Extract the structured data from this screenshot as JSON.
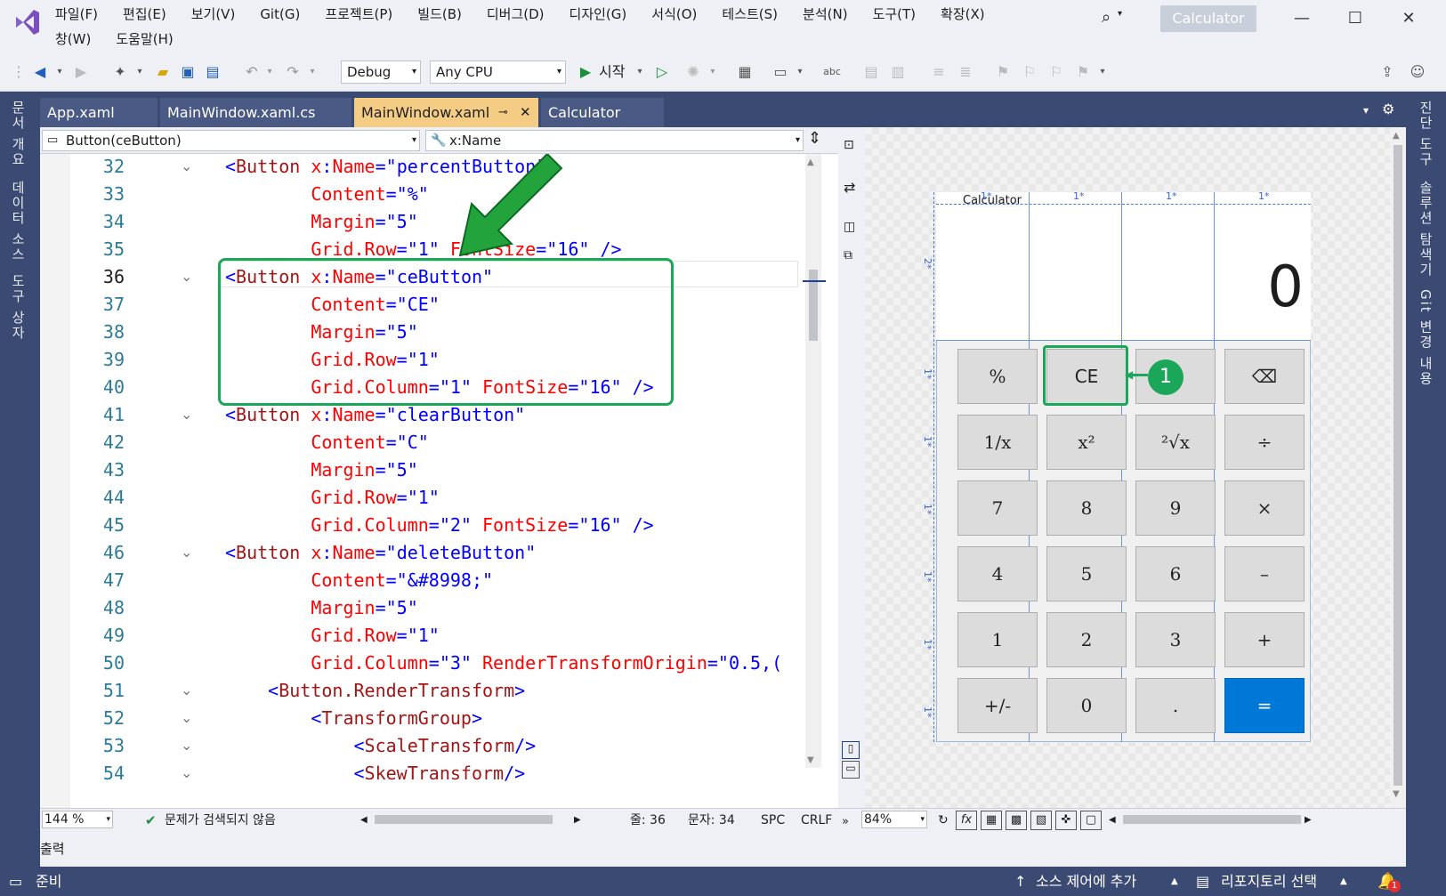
{
  "menu": {
    "row1": [
      "파일(F)",
      "편집(E)",
      "보기(V)",
      "Git(G)",
      "프로젝트(P)",
      "빌드(B)",
      "디버그(D)",
      "디자인(G)",
      "서식(O)",
      "테스트(S)",
      "분석(N)",
      "도구(T)",
      "확장(X)"
    ],
    "row2": [
      "창(W)",
      "도움말(H)"
    ]
  },
  "window": {
    "title": "Calculator"
  },
  "toolbar": {
    "config": "Debug",
    "platform": "Any CPU",
    "start_label": "시작"
  },
  "left_rail": [
    "문서 개요",
    "데이터 소스",
    "도구 상자"
  ],
  "right_rail": [
    "진단 도구",
    "솔루션 탐색기",
    "Git 변경 내용"
  ],
  "tabs": [
    {
      "label": "App.xaml"
    },
    {
      "label": "MainWindow.xaml.cs"
    },
    {
      "label": "MainWindow.xaml",
      "pin": "⊸",
      "close": "✕"
    },
    {
      "label": "Calculator"
    }
  ],
  "nav": {
    "element": "Button(ceButton)",
    "member": "x:Name"
  },
  "code": [
    {
      "n": "32",
      "parts": [
        [
          "br",
          "<"
        ],
        [
          "tag",
          "Button"
        ],
        [
          "at",
          " x"
        ],
        [
          "br",
          ":"
        ],
        [
          "at",
          "Name"
        ],
        [
          "br",
          "=\""
        ],
        [
          "val",
          "percentButton"
        ],
        [
          "br",
          "\""
        ]
      ]
    },
    {
      "n": "33",
      "parts": [
        [
          "at",
          "        Content"
        ],
        [
          "br",
          "=\""
        ],
        [
          "val",
          "%"
        ],
        [
          "br",
          "\""
        ]
      ]
    },
    {
      "n": "34",
      "parts": [
        [
          "at",
          "        Margin"
        ],
        [
          "br",
          "=\""
        ],
        [
          "val",
          "5"
        ],
        [
          "br",
          "\""
        ]
      ]
    },
    {
      "n": "35",
      "parts": [
        [
          "at",
          "        Grid.Row"
        ],
        [
          "br",
          "=\""
        ],
        [
          "val",
          "1"
        ],
        [
          "br",
          "\""
        ],
        [
          "at",
          " FontSize"
        ],
        [
          "br",
          "=\""
        ],
        [
          "val",
          "16"
        ],
        [
          "br",
          "\" />"
        ]
      ]
    },
    {
      "n": "36",
      "parts": [
        [
          "br",
          "<"
        ],
        [
          "tag",
          "Button"
        ],
        [
          "at",
          " x"
        ],
        [
          "br",
          ":"
        ],
        [
          "at",
          "Name"
        ],
        [
          "br",
          "=\""
        ],
        [
          "val",
          "ceButton"
        ],
        [
          "br",
          "\""
        ]
      ]
    },
    {
      "n": "37",
      "parts": [
        [
          "at",
          "        Content"
        ],
        [
          "br",
          "=\""
        ],
        [
          "val",
          "CE"
        ],
        [
          "br",
          "\""
        ]
      ]
    },
    {
      "n": "38",
      "parts": [
        [
          "at",
          "        Margin"
        ],
        [
          "br",
          "=\""
        ],
        [
          "val",
          "5"
        ],
        [
          "br",
          "\""
        ]
      ]
    },
    {
      "n": "39",
      "parts": [
        [
          "at",
          "        Grid.Row"
        ],
        [
          "br",
          "=\""
        ],
        [
          "val",
          "1"
        ],
        [
          "br",
          "\""
        ]
      ]
    },
    {
      "n": "40",
      "parts": [
        [
          "at",
          "        Grid.Column"
        ],
        [
          "br",
          "=\""
        ],
        [
          "val",
          "1"
        ],
        [
          "br",
          "\""
        ],
        [
          "at",
          " FontSize"
        ],
        [
          "br",
          "=\""
        ],
        [
          "val",
          "16"
        ],
        [
          "br",
          "\" />"
        ]
      ]
    },
    {
      "n": "41",
      "parts": [
        [
          "br",
          "<"
        ],
        [
          "tag",
          "Button"
        ],
        [
          "at",
          " x"
        ],
        [
          "br",
          ":"
        ],
        [
          "at",
          "Name"
        ],
        [
          "br",
          "=\""
        ],
        [
          "val",
          "clearButton"
        ],
        [
          "br",
          "\""
        ]
      ]
    },
    {
      "n": "42",
      "parts": [
        [
          "at",
          "        Content"
        ],
        [
          "br",
          "=\""
        ],
        [
          "val",
          "C"
        ],
        [
          "br",
          "\""
        ]
      ]
    },
    {
      "n": "43",
      "parts": [
        [
          "at",
          "        Margin"
        ],
        [
          "br",
          "=\""
        ],
        [
          "val",
          "5"
        ],
        [
          "br",
          "\""
        ]
      ]
    },
    {
      "n": "44",
      "parts": [
        [
          "at",
          "        Grid.Row"
        ],
        [
          "br",
          "=\""
        ],
        [
          "val",
          "1"
        ],
        [
          "br",
          "\""
        ]
      ]
    },
    {
      "n": "45",
      "parts": [
        [
          "at",
          "        Grid.Column"
        ],
        [
          "br",
          "=\""
        ],
        [
          "val",
          "2"
        ],
        [
          "br",
          "\""
        ],
        [
          "at",
          " FontSize"
        ],
        [
          "br",
          "=\""
        ],
        [
          "val",
          "16"
        ],
        [
          "br",
          "\" />"
        ]
      ]
    },
    {
      "n": "46",
      "parts": [
        [
          "br",
          "<"
        ],
        [
          "tag",
          "Button"
        ],
        [
          "at",
          " x"
        ],
        [
          "br",
          ":"
        ],
        [
          "at",
          "Name"
        ],
        [
          "br",
          "=\""
        ],
        [
          "val",
          "deleteButton"
        ],
        [
          "br",
          "\""
        ]
      ]
    },
    {
      "n": "47",
      "parts": [
        [
          "at",
          "        Content"
        ],
        [
          "br",
          "=\""
        ],
        [
          "val",
          "&#8998;"
        ],
        [
          "br",
          "\""
        ]
      ]
    },
    {
      "n": "48",
      "parts": [
        [
          "at",
          "        Margin"
        ],
        [
          "br",
          "=\""
        ],
        [
          "val",
          "5"
        ],
        [
          "br",
          "\""
        ]
      ]
    },
    {
      "n": "49",
      "parts": [
        [
          "at",
          "        Grid.Row"
        ],
        [
          "br",
          "=\""
        ],
        [
          "val",
          "1"
        ],
        [
          "br",
          "\""
        ]
      ]
    },
    {
      "n": "50",
      "parts": [
        [
          "at",
          "        Grid.Column"
        ],
        [
          "br",
          "=\""
        ],
        [
          "val",
          "3"
        ],
        [
          "br",
          "\""
        ],
        [
          "at",
          " RenderTransformOrigin"
        ],
        [
          "br",
          "=\""
        ],
        [
          "val",
          "0.5,("
        ]
      ]
    },
    {
      "n": "51",
      "parts": [
        [
          "br",
          "    <"
        ],
        [
          "tag",
          "Button.RenderTransform"
        ],
        [
          "br",
          ">"
        ]
      ]
    },
    {
      "n": "52",
      "parts": [
        [
          "br",
          "        <"
        ],
        [
          "tag",
          "TransformGroup"
        ],
        [
          "br",
          ">"
        ]
      ]
    },
    {
      "n": "53",
      "parts": [
        [
          "br",
          "            <"
        ],
        [
          "tag",
          "ScaleTransform"
        ],
        [
          "br",
          "/>"
        ]
      ]
    },
    {
      "n": "54",
      "parts": [
        [
          "br",
          "            <"
        ],
        [
          "tag",
          "SkewTransform"
        ],
        [
          "br",
          "/>"
        ]
      ]
    }
  ],
  "editor_status": {
    "zoom": "144 %",
    "issues": "문제가 검색되지 않음",
    "line": "줄: 36",
    "col": "문자: 34",
    "spc": "SPC",
    "eol": "CRLF"
  },
  "design": {
    "window_title": "Calculator",
    "col_markers": [
      "1*",
      "1*",
      "1*",
      "1*"
    ],
    "row_markers": [
      "2*",
      "1*",
      "1*",
      "1*",
      "1*",
      "1*",
      "1*"
    ],
    "display": "0",
    "zoom": "84%",
    "buttons": [
      "%",
      "CE",
      "",
      "⌫",
      "1/x",
      "x²",
      "²√x",
      "÷",
      "7",
      "8",
      "9",
      "×",
      "4",
      "5",
      "6",
      "–",
      "1",
      "2",
      "3",
      "+",
      "+/-",
      "0",
      ".",
      "="
    ],
    "callout": "1"
  },
  "output_label": "출력",
  "status": {
    "ready": "준비",
    "source_control": "소스 제어에 추가",
    "repo": "리포지토리 선택",
    "bell_count": "1"
  },
  "colors": {
    "accent": "#3b4a72",
    "highlight": "#1aa75a",
    "arrow": "#22a33c",
    "equals": "#0078d7",
    "active_tab": "#f5cc84"
  }
}
